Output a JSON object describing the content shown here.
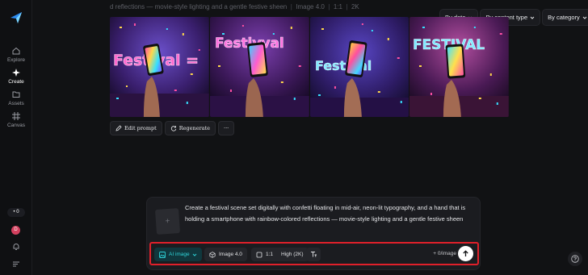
{
  "sidebar": {
    "items": [
      {
        "label": "Explore",
        "icon": "home-icon"
      },
      {
        "label": "Create",
        "icon": "sparkle-icon"
      },
      {
        "label": "Assets",
        "icon": "folder-icon"
      },
      {
        "label": "Canvas",
        "icon": "canvas-icon"
      }
    ],
    "credits": "0",
    "avatar_initial": "D"
  },
  "caption": {
    "text": "d reflections — movie-style lighting and a gentle festive sheen",
    "model": "Image 4.0",
    "ratio": "1:1",
    "quality": "2K"
  },
  "filters": {
    "date": "By date",
    "content_type": "By content type",
    "category": "By category"
  },
  "images": [
    {
      "sign": "Festival ="
    },
    {
      "sign": "Festivval"
    },
    {
      "sign": "Festival"
    },
    {
      "sign": "FESTIVAL"
    }
  ],
  "actions": {
    "edit": "Edit prompt",
    "regenerate": "Regenerate",
    "more": "···"
  },
  "composer": {
    "prompt_line1": "Create a festival scene set digitally with confetti floating in mid-air, neon-lit typography, and a hand that is",
    "prompt_line2": "holding a smartphone with rainbow-colored reflections — movie-style lighting and a gentle festive sheen",
    "mode": "AI image",
    "model": "Image 4.0",
    "ratio": "1:1",
    "quality": "High (2K)",
    "cost": "0/image"
  },
  "colors": {
    "accent": "#2fd3d8",
    "highlight_border": "#e0202a",
    "background": "#111214"
  }
}
